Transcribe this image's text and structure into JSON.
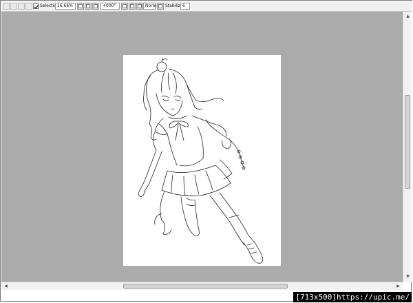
{
  "toolbar": {
    "selection_label": "Selection",
    "selection_checked": true,
    "zoom_value": "16.66%",
    "rotation_value": "+000°",
    "blend_mode_value": "Normal",
    "stabilizer_label": "Stabilizer",
    "stabilizer_value": "6"
  },
  "icons": {
    "new": "new-file-icon",
    "open": "open-file-icon",
    "save": "save-icon",
    "zoom_in": "zoom-in-icon",
    "zoom_out": "zoom-out-icon",
    "zoom_reset": "zoom-reset-icon",
    "rotate_left": "rotate-left-icon",
    "rotate_right": "rotate-right-icon",
    "rotate_reset": "rotate-reset-icon",
    "flip": "flip-icon"
  },
  "scrollbars": {
    "vertical_position": 0.41,
    "horizontal_position": 0.44
  },
  "watermark": {
    "text": "[713x500]https://upic.me/"
  },
  "colors": {
    "canvas_bg": "#ababab",
    "paper": "#ffffff",
    "toolbar_bg": "#f0f0f0",
    "line_art": "#222222"
  }
}
